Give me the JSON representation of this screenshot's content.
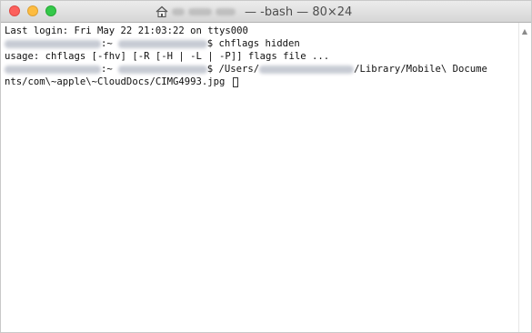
{
  "window": {
    "title": "— -bash — 80×24"
  },
  "terminal": {
    "login_line": "Last login: Fri May 22 21:03:22 on ttys000",
    "prompt_sep": ":~",
    "cmd1": "$ chflags hidden",
    "usage_line": "usage: chflags [-fhv] [-R [-H | -L | -P]] flags file ...",
    "cmd2_prefix": "$ /Users/",
    "cmd2_suffix": "/Library/Mobile\\ Docume",
    "cmd2_wrap": "nts/com\\~apple\\~CloudDocs/CIMG4993.jpg "
  },
  "icons": {
    "home": "home-icon",
    "scroll_up": "scroll-up-arrow-icon"
  },
  "colors": {
    "close": "#fc605c",
    "minimize": "#fdbc40",
    "maximize": "#34c84a"
  }
}
